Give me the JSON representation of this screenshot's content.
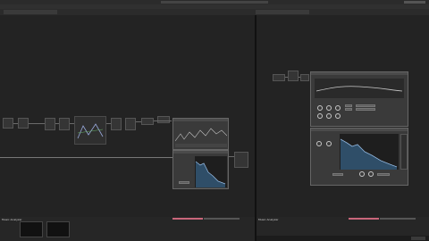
{
  "window": {
    "title_bar_left": "",
    "title_bar_right": "",
    "tab_left": "",
    "tab_right": ""
  },
  "left_pane": {
    "bottom_title": "Music Analyzer",
    "nodes": [
      "",
      "",
      "",
      "",
      "",
      "",
      "",
      "",
      ""
    ]
  },
  "right_pane": {
    "bottom_title": "Music Analyzer"
  },
  "icons": {
    "record": "record-icon",
    "close": "close-icon",
    "grip": "grip-icon"
  },
  "colors": {
    "background": "#1a1a1a",
    "pane": "#232323",
    "accent_pink": "#c9667a",
    "waveform": "#b8d8ff"
  }
}
